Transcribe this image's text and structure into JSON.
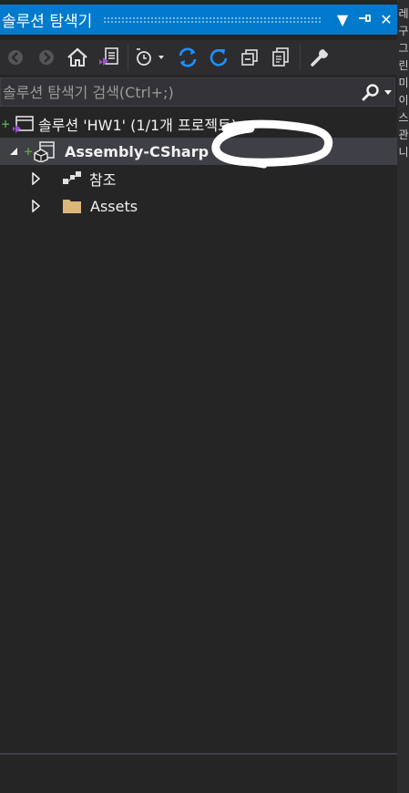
{
  "window": {
    "title": "솔루션 탐색기",
    "pin_glyph": "⊣",
    "close_glyph": "✕",
    "dropdown_glyph": "▼"
  },
  "toolbar": {
    "icons": [
      "back-icon",
      "forward-icon",
      "home-icon",
      "vs-switch-views-icon",
      "pending-changes-filter-icon",
      "sync-icon",
      "refresh-icon",
      "collapse-all-icon",
      "show-all-files-icon",
      "properties-icon"
    ]
  },
  "search": {
    "placeholder": "솔루션 탐색기 검색(Ctrl+;)"
  },
  "tree": {
    "solution_label": "솔루션 'HW1' (1/1개 프로젝트)",
    "project_label": "Assembly-CSharp",
    "references_label": "참조",
    "assets_label": "Assets"
  },
  "side_strip": {
    "chars": [
      "레",
      "구",
      "그",
      "린",
      "미",
      "이",
      "스",
      "관",
      "니"
    ]
  },
  "colors": {
    "accent": "#007acc",
    "panel_bg": "#252526",
    "selected_row": "#3f3f46",
    "vs_purple": "#9b4fcf",
    "folder": "#dcb67a",
    "add_green": "#57a64a"
  }
}
